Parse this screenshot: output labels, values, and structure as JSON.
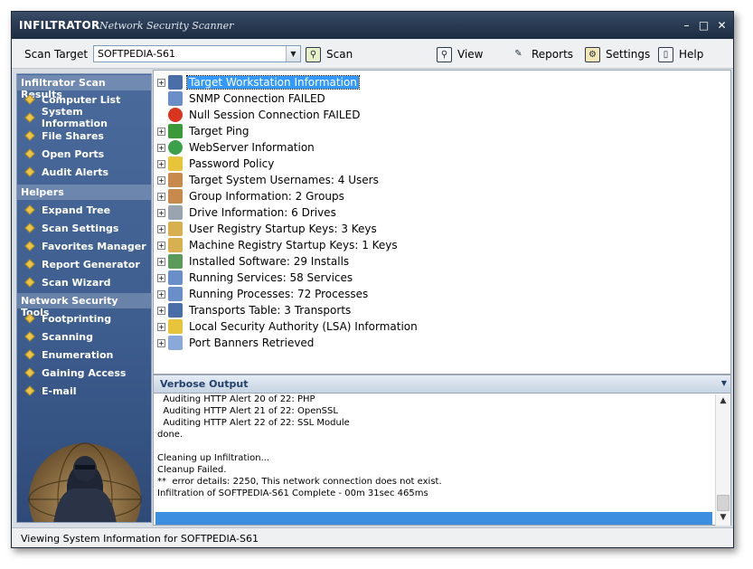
{
  "window": {
    "app_name": "INFILTRATOR",
    "subtitle": "Network Security Scanner",
    "minimize": "–",
    "maximize": "□",
    "close": "✕"
  },
  "toolbar": {
    "scan_target_label": "Scan Target",
    "scan_target_value": "SOFTPEDIA-S61",
    "scan_label": "Scan",
    "view_label": "View",
    "reports_label": "Reports",
    "settings_label": "Settings",
    "help_label": "Help"
  },
  "sidebar": {
    "sections": [
      {
        "title": "Infiltrator Scan Results",
        "items": [
          "Computer List",
          "System Information",
          "File Shares",
          "Open Ports",
          "Audit Alerts"
        ]
      },
      {
        "title": "Helpers",
        "items": [
          "Expand Tree",
          "Scan Settings",
          "Favorites Manager",
          "Report Generator",
          "Scan Wizard"
        ]
      },
      {
        "title": "Network Security Tools",
        "items": [
          "Footprinting",
          "Scanning",
          "Enumeration",
          "Gaining Access",
          "E-mail"
        ]
      }
    ]
  },
  "tree": {
    "items": [
      {
        "label": "Target Workstation Information",
        "icon": "computer-icon",
        "expander": "+",
        "selected": true,
        "color": "#4a6fa8"
      },
      {
        "label": "SNMP Connection FAILED",
        "icon": "network-icon",
        "expander": "",
        "color": "#6a8fc8"
      },
      {
        "label": "Null Session Connection FAILED",
        "icon": "error-icon",
        "expander": "",
        "color": "#d9341f"
      },
      {
        "label": "Target Ping",
        "icon": "ping-icon",
        "expander": "+",
        "color": "#3a9a3a"
      },
      {
        "label": "WebServer Information",
        "icon": "globe-icon",
        "expander": "+",
        "color": "#3aa04a"
      },
      {
        "label": "Password Policy",
        "icon": "lock-icon",
        "expander": "+",
        "color": "#e8c43a"
      },
      {
        "label": "Target System Usernames: 4 Users",
        "icon": "user-icon",
        "expander": "+",
        "color": "#c88a4a"
      },
      {
        "label": "Group Information: 2 Groups",
        "icon": "group-icon",
        "expander": "+",
        "color": "#c88a4a"
      },
      {
        "label": "Drive Information: 6 Drives",
        "icon": "drive-icon",
        "expander": "+",
        "color": "#9aa4b0"
      },
      {
        "label": "User Registry Startup Keys: 3 Keys",
        "icon": "registry-icon",
        "expander": "+",
        "color": "#d8b050"
      },
      {
        "label": "Machine Registry Startup Keys: 1 Keys",
        "icon": "registry-icon",
        "expander": "+",
        "color": "#d8b050"
      },
      {
        "label": "Installed Software: 29 Installs",
        "icon": "software-icon",
        "expander": "+",
        "color": "#5a9a5a"
      },
      {
        "label": "Running Services: 58 Services",
        "icon": "services-icon",
        "expander": "+",
        "color": "#6a8fc8"
      },
      {
        "label": "Running Processes: 72 Processes",
        "icon": "processes-icon",
        "expander": "+",
        "color": "#6a8fc8"
      },
      {
        "label": "Transports Table: 3 Transports",
        "icon": "transport-icon",
        "expander": "+",
        "color": "#4a6fa8"
      },
      {
        "label": "Local Security Authority (LSA) Information",
        "icon": "lock-icon",
        "expander": "+",
        "color": "#e8c43a"
      },
      {
        "label": "Port Banners Retrieved",
        "icon": "document-icon",
        "expander": "+",
        "color": "#8aa8d8"
      }
    ]
  },
  "verbose": {
    "title": "Verbose Output",
    "lines": [
      "  Auditing HTTP Alert 20 of 22: PHP",
      "  Auditing HTTP Alert 21 of 22: OpenSSL",
      "  Auditing HTTP Alert 22 of 22: SSL Module",
      "done.",
      "",
      "Cleaning up Infiltration...",
      "Cleanup Failed.",
      "**  error details: 2250, This network connection does not exist.",
      "Infiltration of SOFTPEDIA-S61 Complete - 00m 31sec 465ms"
    ],
    "progress": 1.0
  },
  "status": {
    "text": "Viewing System Information for SOFTPEDIA-S61"
  },
  "colors": {
    "accent": "#3399ff",
    "sidebar_bg": "#3e5e90",
    "titlebar_bg": "#2a3c54"
  }
}
